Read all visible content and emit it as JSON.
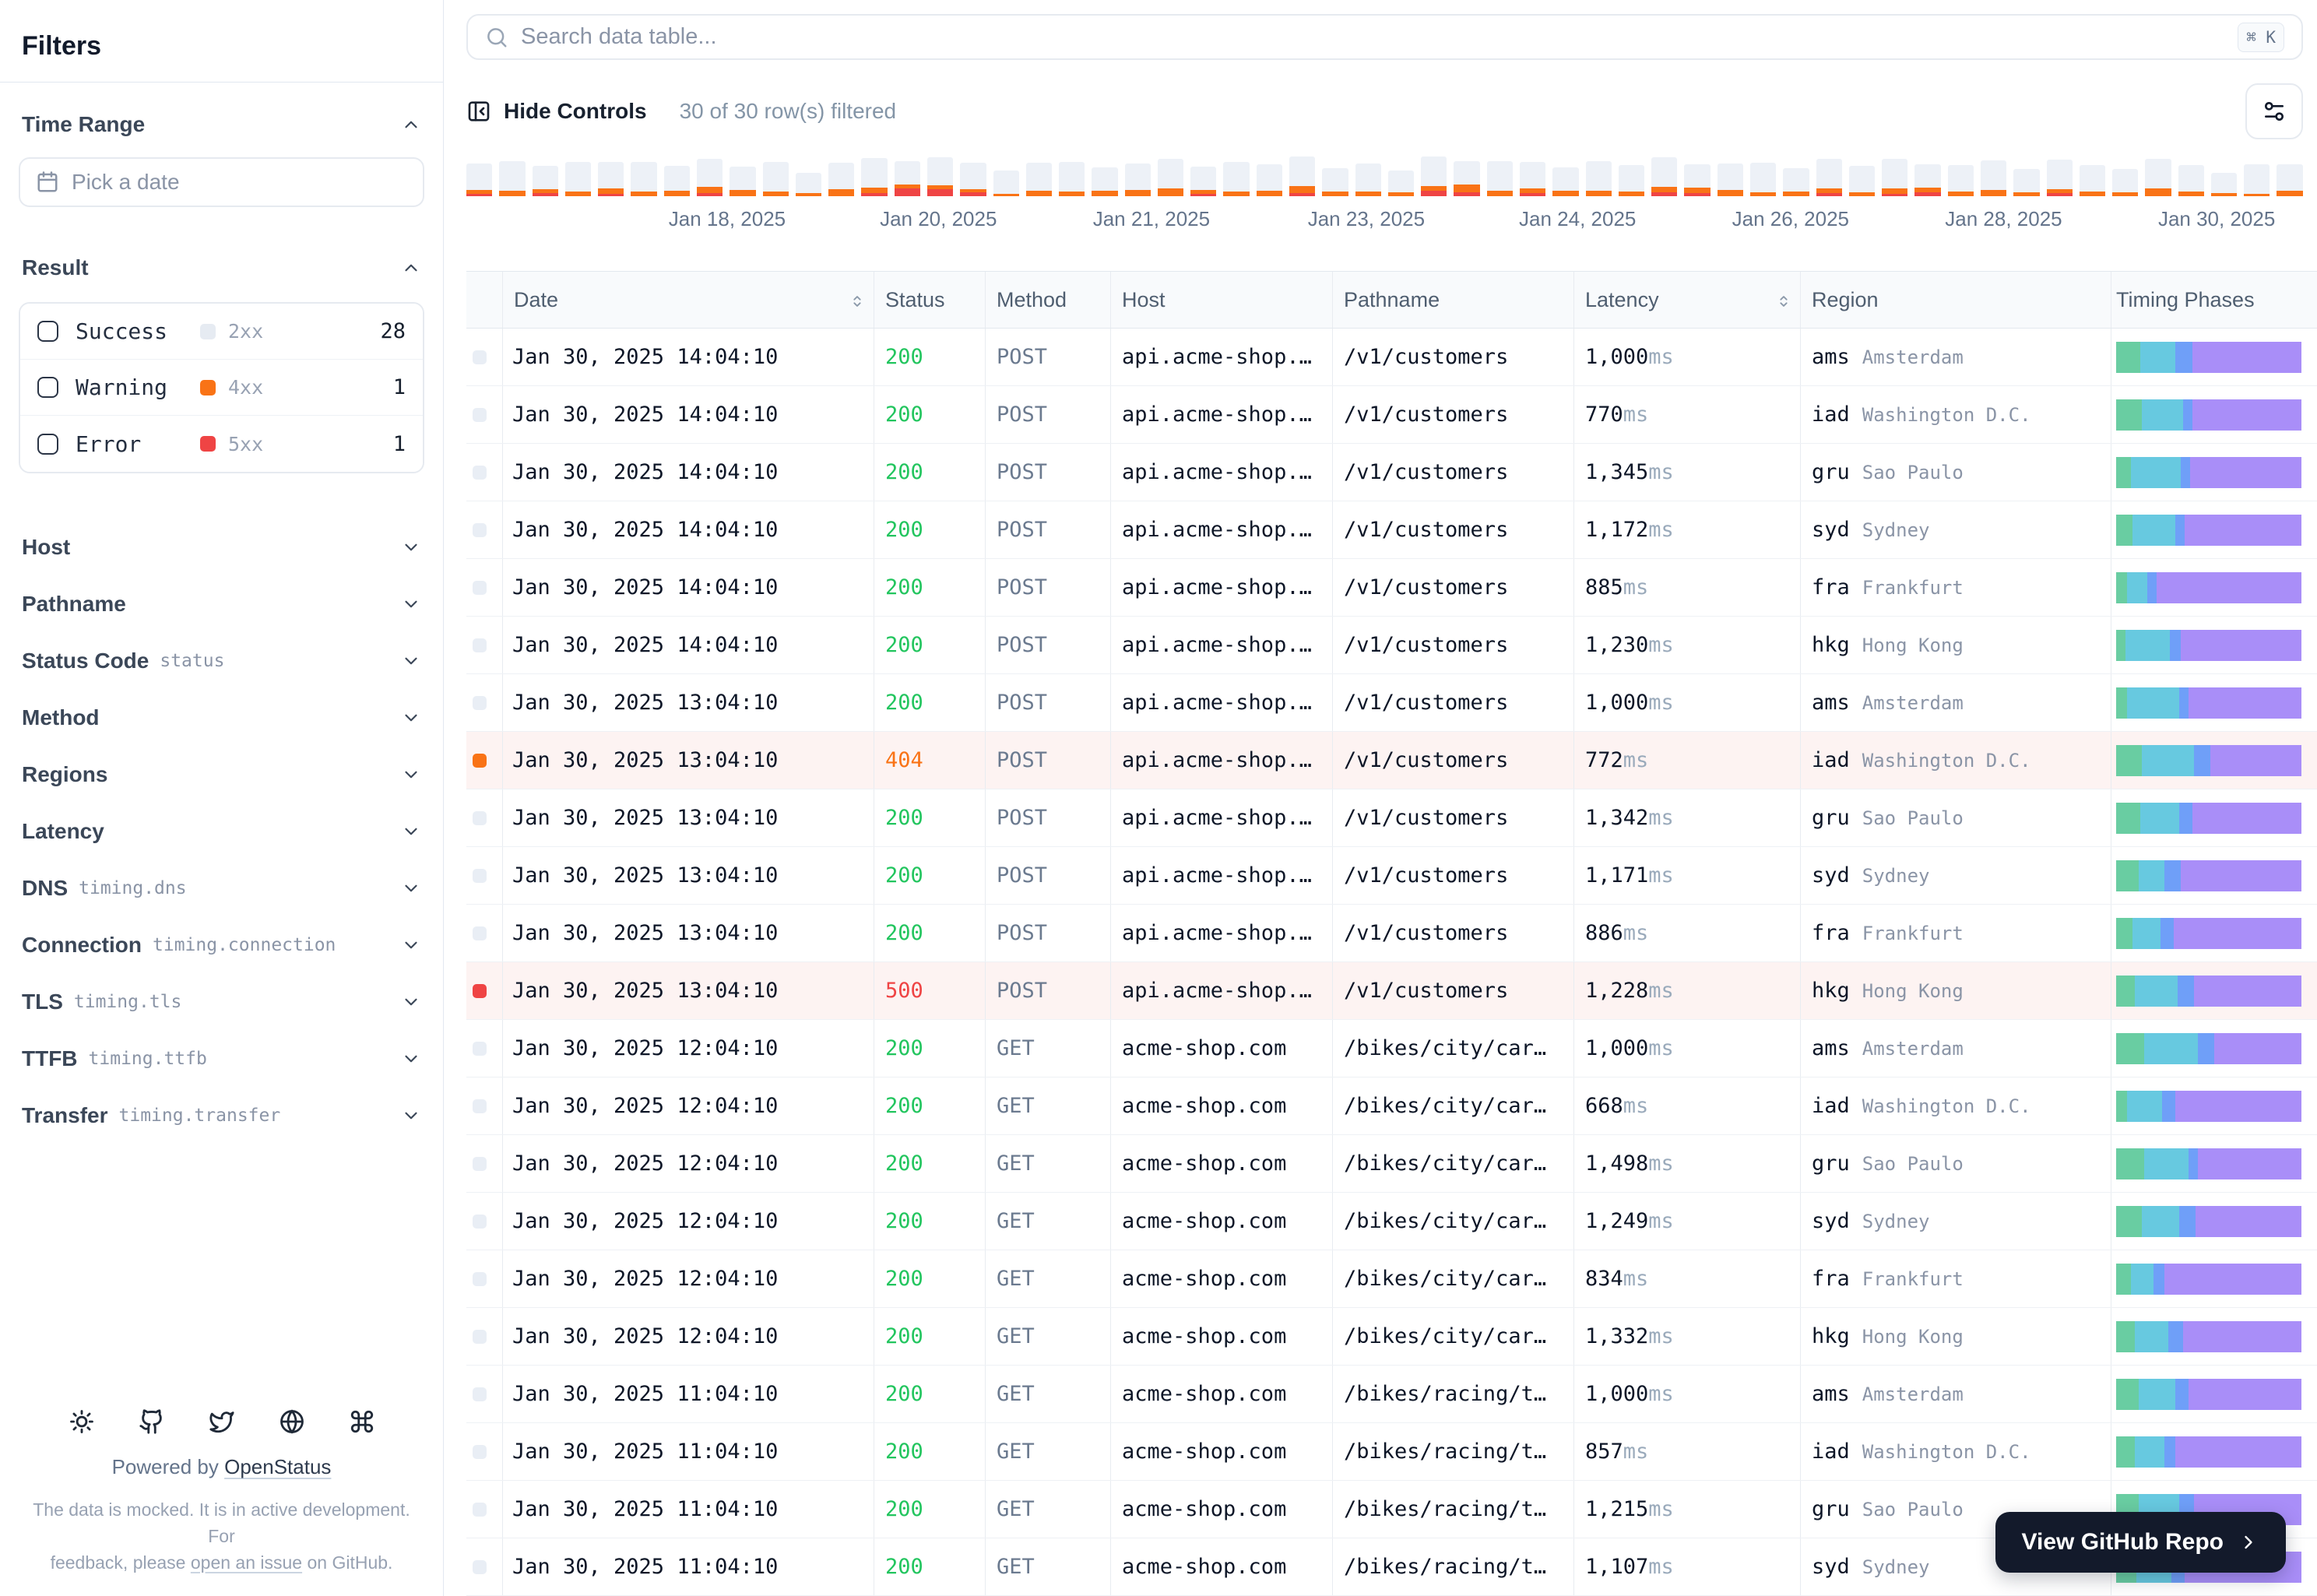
{
  "sidebar": {
    "title": "Filters",
    "time_range": {
      "label": "Time Range",
      "picker_placeholder": "Pick a date"
    },
    "result": {
      "label": "Result",
      "options": [
        {
          "label": "Success",
          "code": "2xx",
          "count": "28"
        },
        {
          "label": "Warning",
          "code": "4xx",
          "count": "1"
        },
        {
          "label": "Error",
          "code": "5xx",
          "count": "1"
        }
      ]
    },
    "filters": [
      {
        "label": "Host",
        "code": ""
      },
      {
        "label": "Pathname",
        "code": ""
      },
      {
        "label": "Status Code",
        "code": "status"
      },
      {
        "label": "Method",
        "code": ""
      },
      {
        "label": "Regions",
        "code": ""
      },
      {
        "label": "Latency",
        "code": ""
      },
      {
        "label": "DNS",
        "code": "timing.dns"
      },
      {
        "label": "Connection",
        "code": "timing.connection"
      },
      {
        "label": "TLS",
        "code": "timing.tls"
      },
      {
        "label": "TTFB",
        "code": "timing.ttfb"
      },
      {
        "label": "Transfer",
        "code": "timing.transfer"
      }
    ],
    "footer": {
      "icons": [
        "sun",
        "github",
        "twitter",
        "globe",
        "command"
      ],
      "powered_prefix": "Powered by",
      "brand_link": "OpenStatus",
      "note_line1": "The data is mocked. It is in active development. For",
      "note_line2_pre": "feedback, please ",
      "note_line2_link": "open an issue",
      "note_line2_post": " on GitHub."
    }
  },
  "search": {
    "placeholder": "Search data table...",
    "shortcut": "⌘ K"
  },
  "toolbar": {
    "hide_controls": "Hide Controls",
    "filtered": "30 of 30 row(s) filtered"
  },
  "chart_data": {
    "type": "bar",
    "title": "",
    "stacked": true,
    "x_labels": [
      "Jan 18, 2025",
      "Jan 20, 2025",
      "Jan 21, 2025",
      "Jan 23, 2025",
      "Jan 24, 2025",
      "Jan 26, 2025",
      "Jan 28, 2025",
      "Jan 30, 2025"
    ],
    "label_pos": [
      14.2,
      25.7,
      37.3,
      49.0,
      60.5,
      72.1,
      83.7,
      95.3
    ],
    "legend": "off",
    "grid": "off",
    "series": [
      {
        "name": "success",
        "color": "#edf1f7",
        "values": [
          34,
          38,
          30,
          38,
          34,
          38,
          32,
          36,
          30,
          38,
          26,
          34,
          38,
          30,
          36,
          34,
          30,
          36,
          38,
          30,
          34,
          38,
          30,
          38,
          34,
          38,
          30,
          36,
          28,
          38,
          30,
          38,
          34,
          30,
          38,
          34,
          38,
          30,
          34,
          38,
          30,
          38,
          34,
          38,
          30,
          34,
          38,
          30,
          38,
          34,
          30,
          38,
          34,
          26,
          38,
          34
        ]
      },
      {
        "name": "warning",
        "color": "#f97316",
        "values": [
          5,
          7,
          5,
          6,
          7,
          6,
          7,
          8,
          8,
          6,
          4,
          9,
          7,
          5,
          5,
          4,
          3,
          7,
          6,
          7,
          8,
          10,
          5,
          6,
          7,
          9,
          6,
          6,
          5,
          6,
          10,
          7,
          6,
          7,
          7,
          6,
          7,
          7,
          8,
          5,
          6,
          6,
          5,
          7,
          6,
          6,
          8,
          5,
          5,
          6,
          5,
          10,
          6,
          4,
          3,
          7
        ]
      },
      {
        "name": "error",
        "color": "#ef4444",
        "values": [
          3,
          0,
          4,
          0,
          3,
          0,
          0,
          4,
          0,
          0,
          0,
          0,
          4,
          10,
          9,
          5,
          0,
          0,
          0,
          0,
          0,
          0,
          3,
          0,
          0,
          4,
          0,
          0,
          0,
          7,
          5,
          0,
          4,
          0,
          0,
          0,
          5,
          4,
          0,
          0,
          0,
          4,
          0,
          3,
          5,
          0,
          0,
          0,
          4,
          0,
          0,
          0,
          0,
          0,
          0,
          0
        ]
      }
    ]
  },
  "table": {
    "latency_unit": "ms",
    "columns": [
      {
        "label": "",
        "sortable": false
      },
      {
        "label": "Date",
        "sortable": true
      },
      {
        "label": "Status",
        "sortable": false
      },
      {
        "label": "Method",
        "sortable": false
      },
      {
        "label": "Host",
        "sortable": false
      },
      {
        "label": "Pathname",
        "sortable": false
      },
      {
        "label": "Latency",
        "sortable": true
      },
      {
        "label": "Region",
        "sortable": false
      },
      {
        "label": "Timing Phases",
        "sortable": false
      }
    ],
    "rows": [
      {
        "date": "Jan 30, 2025 14:04:10",
        "status": "200",
        "level": "success",
        "method": "POST",
        "host": "api.acme-shop.…",
        "pathname": "/v1/customers",
        "latency": "1,000",
        "region": "ams",
        "city": "Amsterdam",
        "timing": [
          13,
          19,
          9,
          59
        ]
      },
      {
        "date": "Jan 30, 2025 14:04:10",
        "status": "200",
        "level": "success",
        "method": "POST",
        "host": "api.acme-shop.…",
        "pathname": "/v1/customers",
        "latency": "770",
        "region": "iad",
        "city": "Washington D.C.",
        "timing": [
          14,
          22,
          5,
          59
        ]
      },
      {
        "date": "Jan 30, 2025 14:04:10",
        "status": "200",
        "level": "success",
        "method": "POST",
        "host": "api.acme-shop.…",
        "pathname": "/v1/customers",
        "latency": "1,345",
        "region": "gru",
        "city": "Sao Paulo",
        "timing": [
          8,
          27,
          5,
          60
        ]
      },
      {
        "date": "Jan 30, 2025 14:04:10",
        "status": "200",
        "level": "success",
        "method": "POST",
        "host": "api.acme-shop.…",
        "pathname": "/v1/customers",
        "latency": "1,172",
        "region": "syd",
        "city": "Sydney",
        "timing": [
          9,
          23,
          5,
          63
        ]
      },
      {
        "date": "Jan 30, 2025 14:04:10",
        "status": "200",
        "level": "success",
        "method": "POST",
        "host": "api.acme-shop.…",
        "pathname": "/v1/customers",
        "latency": "885",
        "region": "fra",
        "city": "Frankfurt",
        "timing": [
          6,
          11,
          5,
          78
        ]
      },
      {
        "date": "Jan 30, 2025 14:04:10",
        "status": "200",
        "level": "success",
        "method": "POST",
        "host": "api.acme-shop.…",
        "pathname": "/v1/customers",
        "latency": "1,230",
        "region": "hkg",
        "city": "Hong Kong",
        "timing": [
          5,
          24,
          6,
          65
        ]
      },
      {
        "date": "Jan 30, 2025 13:04:10",
        "status": "200",
        "level": "success",
        "method": "POST",
        "host": "api.acme-shop.…",
        "pathname": "/v1/customers",
        "latency": "1,000",
        "region": "ams",
        "city": "Amsterdam",
        "timing": [
          6,
          28,
          5,
          61
        ]
      },
      {
        "date": "Jan 30, 2025 13:04:10",
        "status": "404",
        "level": "warning",
        "method": "POST",
        "host": "api.acme-shop.…",
        "pathname": "/v1/customers",
        "latency": "772",
        "region": "iad",
        "city": "Washington D.C.",
        "timing": [
          14,
          28,
          9,
          49
        ]
      },
      {
        "date": "Jan 30, 2025 13:04:10",
        "status": "200",
        "level": "success",
        "method": "POST",
        "host": "api.acme-shop.…",
        "pathname": "/v1/customers",
        "latency": "1,342",
        "region": "gru",
        "city": "Sao Paulo",
        "timing": [
          13,
          21,
          7,
          59
        ]
      },
      {
        "date": "Jan 30, 2025 13:04:10",
        "status": "200",
        "level": "success",
        "method": "POST",
        "host": "api.acme-shop.…",
        "pathname": "/v1/customers",
        "latency": "1,171",
        "region": "syd",
        "city": "Sydney",
        "timing": [
          12,
          14,
          9,
          65
        ]
      },
      {
        "date": "Jan 30, 2025 13:04:10",
        "status": "200",
        "level": "success",
        "method": "POST",
        "host": "api.acme-shop.…",
        "pathname": "/v1/customers",
        "latency": "886",
        "region": "fra",
        "city": "Frankfurt",
        "timing": [
          9,
          15,
          7,
          69
        ]
      },
      {
        "date": "Jan 30, 2025 13:04:10",
        "status": "500",
        "level": "error",
        "method": "POST",
        "host": "api.acme-shop.…",
        "pathname": "/v1/customers",
        "latency": "1,228",
        "region": "hkg",
        "city": "Hong Kong",
        "timing": [
          10,
          23,
          9,
          58
        ]
      },
      {
        "date": "Jan 30, 2025 12:04:10",
        "status": "200",
        "level": "success",
        "method": "GET",
        "host": "acme-shop.com",
        "pathname": "/bikes/city/car…",
        "latency": "1,000",
        "region": "ams",
        "city": "Amsterdam",
        "timing": [
          15,
          29,
          9,
          47
        ]
      },
      {
        "date": "Jan 30, 2025 12:04:10",
        "status": "200",
        "level": "success",
        "method": "GET",
        "host": "acme-shop.com",
        "pathname": "/bikes/city/car…",
        "latency": "668",
        "region": "iad",
        "city": "Washington D.C.",
        "timing": [
          6,
          19,
          7,
          68
        ]
      },
      {
        "date": "Jan 30, 2025 12:04:10",
        "status": "200",
        "level": "success",
        "method": "GET",
        "host": "acme-shop.com",
        "pathname": "/bikes/city/car…",
        "latency": "1,498",
        "region": "gru",
        "city": "Sao Paulo",
        "timing": [
          15,
          24,
          5,
          56
        ]
      },
      {
        "date": "Jan 30, 2025 12:04:10",
        "status": "200",
        "level": "success",
        "method": "GET",
        "host": "acme-shop.com",
        "pathname": "/bikes/city/car…",
        "latency": "1,249",
        "region": "syd",
        "city": "Sydney",
        "timing": [
          14,
          20,
          9,
          57
        ]
      },
      {
        "date": "Jan 30, 2025 12:04:10",
        "status": "200",
        "level": "success",
        "method": "GET",
        "host": "acme-shop.com",
        "pathname": "/bikes/city/car…",
        "latency": "834",
        "region": "fra",
        "city": "Frankfurt",
        "timing": [
          8,
          12,
          6,
          74
        ]
      },
      {
        "date": "Jan 30, 2025 12:04:10",
        "status": "200",
        "level": "success",
        "method": "GET",
        "host": "acme-shop.com",
        "pathname": "/bikes/city/car…",
        "latency": "1,332",
        "region": "hkg",
        "city": "Hong Kong",
        "timing": [
          10,
          18,
          8,
          64
        ]
      },
      {
        "date": "Jan 30, 2025 11:04:10",
        "status": "200",
        "level": "success",
        "method": "GET",
        "host": "acme-shop.com",
        "pathname": "/bikes/racing/t…",
        "latency": "1,000",
        "region": "ams",
        "city": "Amsterdam",
        "timing": [
          12,
          20,
          7,
          61
        ]
      },
      {
        "date": "Jan 30, 2025 11:04:10",
        "status": "200",
        "level": "success",
        "method": "GET",
        "host": "acme-shop.com",
        "pathname": "/bikes/racing/t…",
        "latency": "857",
        "region": "iad",
        "city": "Washington D.C.",
        "timing": [
          10,
          16,
          6,
          68
        ]
      },
      {
        "date": "Jan 30, 2025 11:04:10",
        "status": "200",
        "level": "success",
        "method": "GET",
        "host": "acme-shop.com",
        "pathname": "/bikes/racing/t…",
        "latency": "1,215",
        "region": "gru",
        "city": "Sao Paulo",
        "timing": [
          12,
          22,
          8,
          58
        ]
      },
      {
        "date": "Jan 30, 2025 11:04:10",
        "status": "200",
        "level": "success",
        "method": "GET",
        "host": "acme-shop.com",
        "pathname": "/bikes/racing/t…",
        "latency": "1,107",
        "region": "syd",
        "city": "Sydney",
        "timing": [
          11,
          19,
          7,
          63
        ]
      }
    ]
  },
  "github_button": {
    "label": "View GitHub Repo"
  },
  "colors": {
    "success_status": "#22c55e",
    "warning_status": "#f97316",
    "error_status": "#ef4444",
    "row_alert_bg": "#fdf3f2",
    "histogram_base": "#edf1f7",
    "timing_dns": "#69cda2",
    "timing_connection": "#67c9e0",
    "timing_tls": "#6f9ff8",
    "timing_ttfb": "#a98ef8",
    "dark_button_bg": "#131a2b",
    "border": "#e2e8f0"
  }
}
